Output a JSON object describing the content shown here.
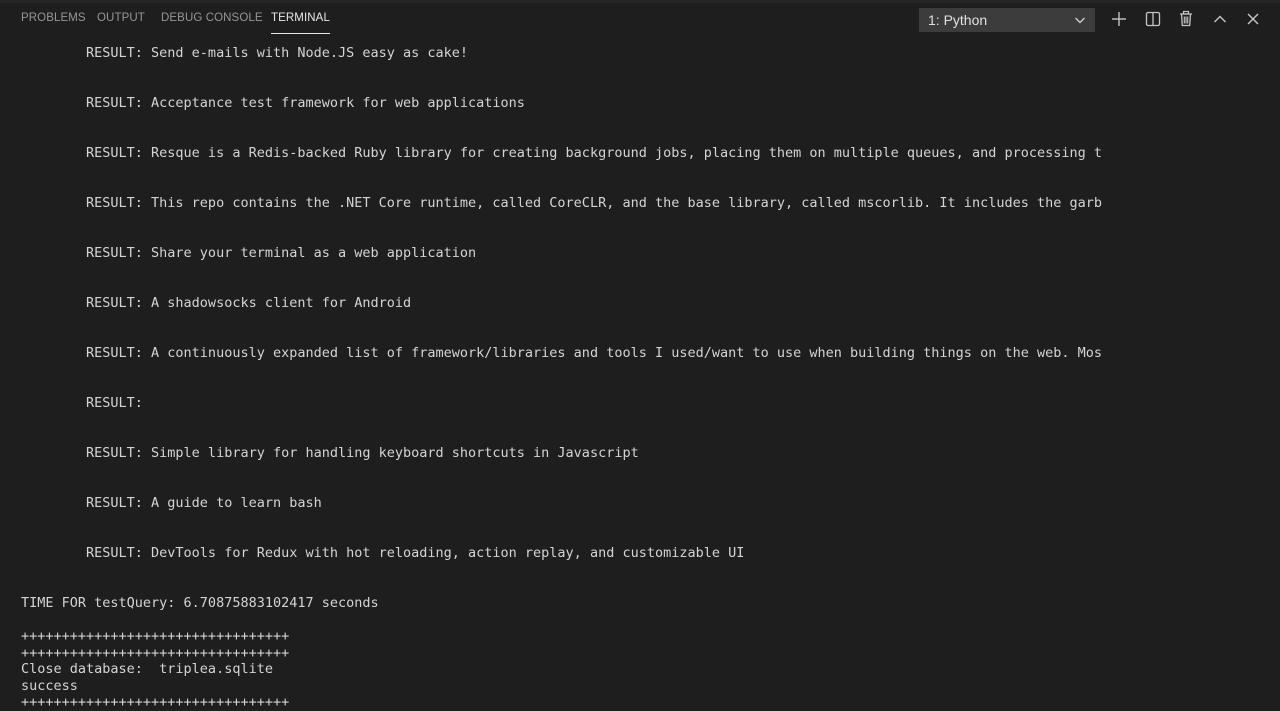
{
  "tabs": [
    {
      "label": "PROBLEMS"
    },
    {
      "label": "OUTPUT"
    },
    {
      "label": "DEBUG CONSOLE"
    },
    {
      "label": "TERMINAL",
      "active": true
    }
  ],
  "terminal_select": {
    "value": "1: Python"
  },
  "actions": [
    {
      "icon": "plus-icon"
    },
    {
      "icon": "split-icon"
    },
    {
      "icon": "trash-icon"
    },
    {
      "icon": "chevron-up-icon"
    },
    {
      "icon": "close-icon"
    }
  ],
  "terminal": {
    "results": [
      "        RESULT: Send e-mails with Node.JS easy as cake!",
      "        RESULT: Acceptance test framework for web applications",
      "        RESULT: Resque is a Redis-backed Ruby library for creating background jobs, placing them on multiple queues, and processing t",
      "        RESULT: This repo contains the .NET Core runtime, called CoreCLR, and the base library, called mscorlib. It includes the garb",
      "        RESULT: Share your terminal as a web application",
      "        RESULT: A shadowsocks client for Android",
      "        RESULT: A continuously expanded list of framework/libraries and tools I used/want to use when building things on the web. Mos",
      "        RESULT:",
      "        RESULT: Simple library for handling keyboard shortcuts in Javascript",
      "        RESULT: A guide to learn bash",
      "        RESULT: DevTools for Redux with hot reloading, action replay, and customizable UI"
    ],
    "time_line": "TIME FOR testQuery: 6.70875883102417 seconds",
    "separator_1": "+++++++++++++++++++++++++++++++++",
    "separator_2": "+++++++++++++++++++++++++++++++++",
    "close_line": "Close database:  triplea.sqlite",
    "status_line": "success",
    "separator_3": "+++++++++++++++++++++++++++++++++"
  }
}
